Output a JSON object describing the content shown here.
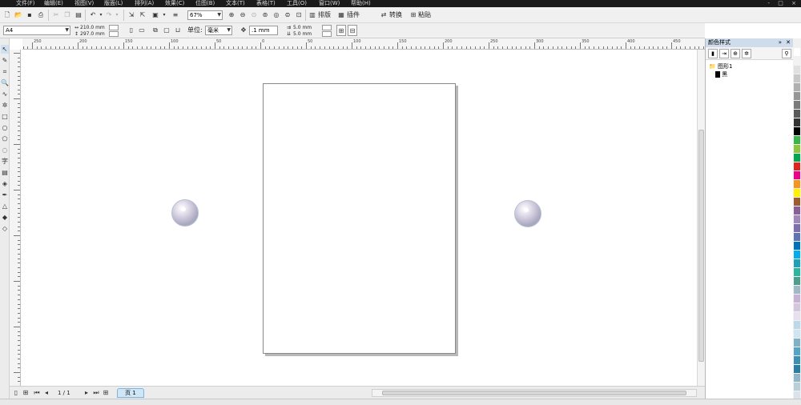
{
  "menu": {
    "items": [
      "文件(F)",
      "编辑(E)",
      "视图(V)",
      "版面(L)",
      "排列(A)",
      "效果(C)",
      "位图(B)",
      "文本(T)",
      "表格(T)",
      "工具(O)",
      "窗口(W)",
      "帮助(H)"
    ],
    "window_controls": "- □ ×"
  },
  "toolbar": {
    "zoom_value": "67%",
    "layout_label": "排版",
    "plugin_label": "插件",
    "convert_label": "转换",
    "paste_label": "粘贴"
  },
  "propertybar": {
    "paper_size": "A4",
    "width": "210.0 mm",
    "height": "297.0 mm",
    "units_label": "单位:",
    "units_value": "毫米",
    "nudge": ".1 mm",
    "dup_x": "5.0 mm",
    "dup_y": "5.0 mm"
  },
  "ruler": {
    "h_labels": [
      "250",
      "200",
      "150",
      "100",
      "50",
      "0",
      "50",
      "100",
      "150",
      "200",
      "250",
      "300",
      "350",
      "400",
      "450"
    ]
  },
  "bottom": {
    "page_counter": "1 / 1",
    "page_tab": "页 1"
  },
  "panel": {
    "title": "颜色样式",
    "tree_root": "图形1",
    "tree_child": "黑"
  },
  "colors": {
    "palette": [
      "#ffffff",
      "#f2f2f2",
      "#e0e0e0",
      "#c8c8c8",
      "#b0b0b0",
      "#969696",
      "#7a7a7a",
      "#5a5a5a",
      "#333333",
      "#000000",
      "#3ab54a",
      "#8cc63f",
      "#00a651",
      "#e2231a",
      "#ec008c",
      "#f7941d",
      "#fff200",
      "#a05a2c",
      "#8b5e99",
      "#a186be",
      "#7e6eb0",
      "#5e73b6",
      "#0072bc",
      "#00aeef",
      "#1fa0b8",
      "#2bb6a2",
      "#4f9d8c",
      "#9fb9c9",
      "#c7b1d4",
      "#d5c6e0",
      "#e8e0ee",
      "#bcd9ea",
      "#cfe6f2",
      "#7fb2c7",
      "#56a5c8",
      "#3d8fb5",
      "#2a7ea6",
      "#8fb7c9",
      "#b9cfd8",
      "#d8e4e9"
    ]
  }
}
